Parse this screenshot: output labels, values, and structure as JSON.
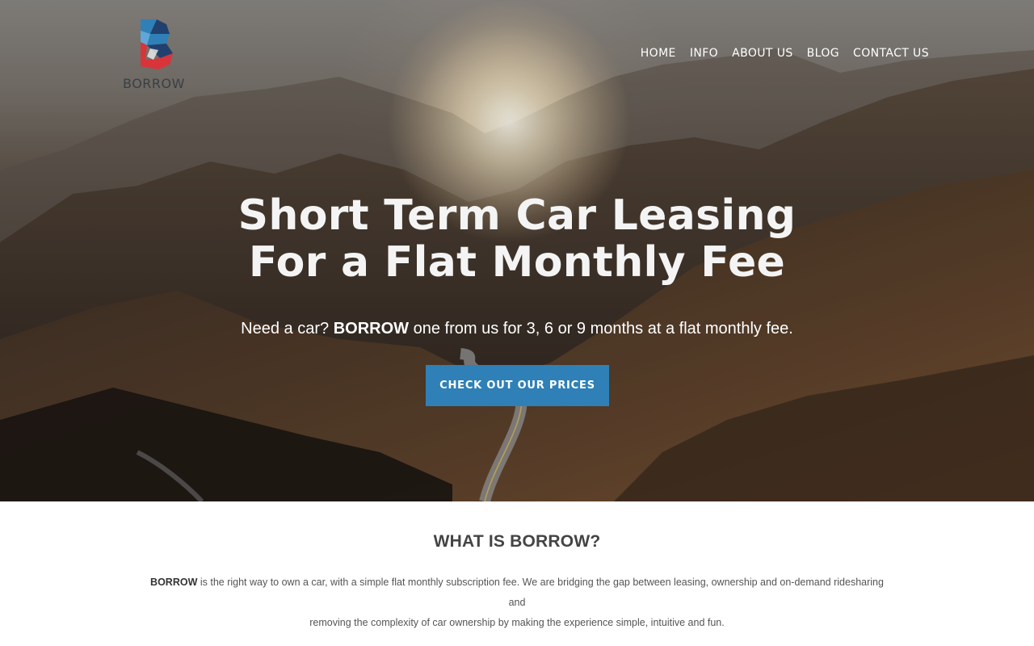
{
  "brand": {
    "name": "BORROW",
    "colors": {
      "blue": "#2f80b7",
      "red": "#d8343a",
      "navy": "#21406e"
    }
  },
  "nav": {
    "items": [
      "HOME",
      "INFO",
      "ABOUT US",
      "BLOG",
      "CONTACT US"
    ]
  },
  "hero": {
    "title_line1": "Short Term Car Leasing",
    "title_line2": "For a Flat Monthly Fee",
    "subtitle_prefix": "Need a car?",
    "subtitle_brand": "BORROW",
    "subtitle_suffix": "one from us for 3, 6 or 9 months at a flat monthly fee.",
    "cta_label": "CHECK OUT OUR PRICES",
    "cta_color": "#2f80b7"
  },
  "about": {
    "heading": "WHAT IS BORROW?",
    "body_brand": "BORROW",
    "body_line1": "is the right way to own a car, with a simple flat monthly subscription fee. We are bridging the gap between leasing, ownership and on-demand ridesharing and",
    "body_line2": "removing the complexity of car ownership by making the experience simple, intuitive and fun."
  }
}
